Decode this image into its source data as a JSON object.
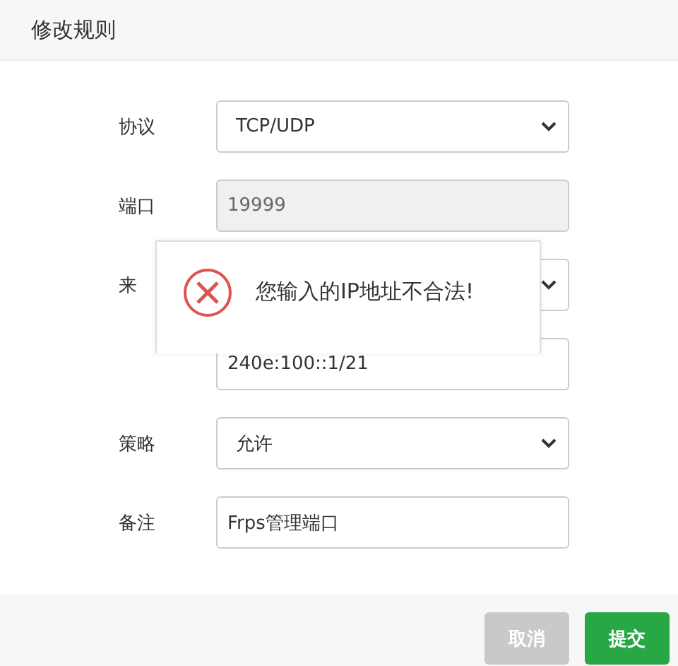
{
  "dialog": {
    "title": "修改规则"
  },
  "fields": [
    {
      "kind": "select",
      "label": "协议",
      "value": "TCP/UDP",
      "disabled": false
    },
    {
      "kind": "input",
      "label": "端口",
      "value": "19999",
      "disabled": true
    },
    {
      "kind": "select",
      "label": "来",
      "disabled": false
    },
    {
      "kind": "input",
      "value": "240e:100::1/21",
      "disabled": false
    },
    {
      "kind": "select",
      "label": "策略",
      "value": "允许",
      "disabled": false
    },
    {
      "kind": "input",
      "label": "备注",
      "value": "Frps管理端口",
      "disabled": false
    }
  ],
  "toast": {
    "kind": "error",
    "message": "您输入的IP地址不合法!"
  },
  "buttons": [
    {
      "label": "取消",
      "kind": "cancel"
    },
    {
      "label": "提交",
      "kind": "primary"
    }
  ]
}
